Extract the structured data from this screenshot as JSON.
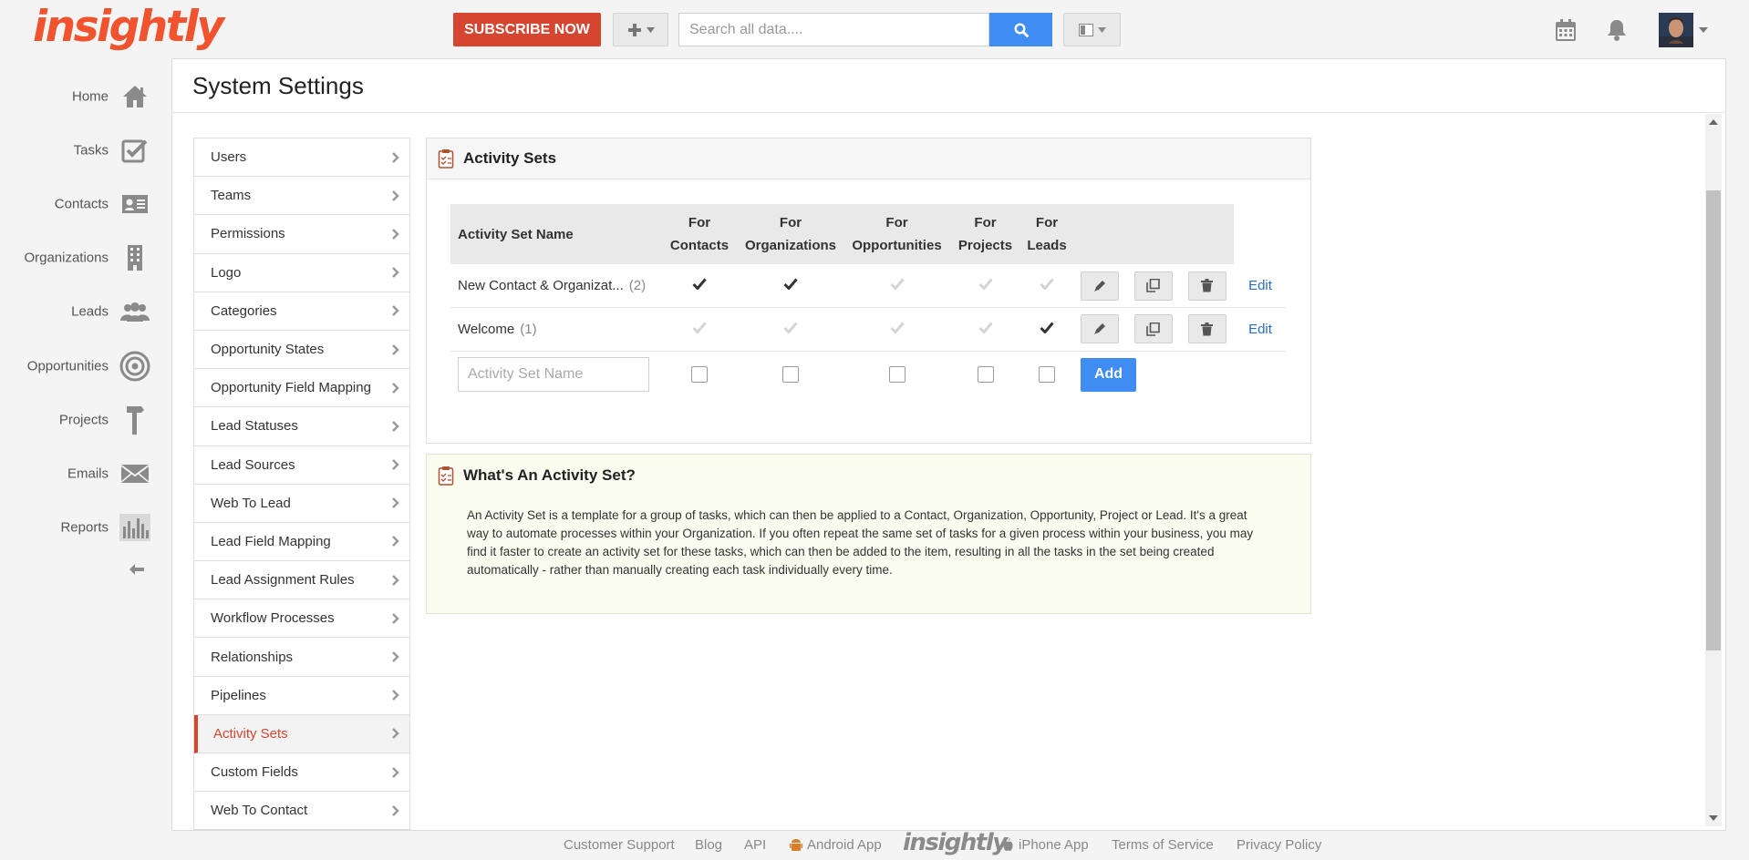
{
  "app": {
    "logo_text": "insightly",
    "brand_color": "#f0532d",
    "accent_color": "#3f8df2"
  },
  "topbar": {
    "subscribe_label": "SUBSCRIBE NOW",
    "add_icon": "plus-icon",
    "search_placeholder": "Search all data....",
    "search_icon": "search-icon",
    "layout_icon": "layout-icon",
    "calendar_icon": "calendar-icon",
    "bell_icon": "bell-icon",
    "avatar": "user-avatar"
  },
  "nav": {
    "items": [
      {
        "label": "Home",
        "icon": "home-icon"
      },
      {
        "label": "Tasks",
        "icon": "tasks-check-icon"
      },
      {
        "label": "Contacts",
        "icon": "contact-card-icon"
      },
      {
        "label": "Organizations",
        "icon": "building-icon"
      },
      {
        "label": "Leads",
        "icon": "people-icon"
      },
      {
        "label": "Opportunities",
        "icon": "target-icon"
      },
      {
        "label": "Projects",
        "icon": "hammer-icon"
      },
      {
        "label": "Emails",
        "icon": "envelope-icon"
      },
      {
        "label": "Reports",
        "icon": "bar-chart-icon"
      }
    ],
    "collapse_icon": "arrow-left-icon"
  },
  "page": {
    "title": "System Settings"
  },
  "settings": {
    "active": "Activity Sets",
    "items": [
      "Users",
      "Teams",
      "Permissions",
      "Logo",
      "Categories",
      "Opportunity States",
      "Opportunity Field Mapping",
      "Lead Statuses",
      "Lead Sources",
      "Web To Lead",
      "Lead Field Mapping",
      "Lead Assignment Rules",
      "Workflow Processes",
      "Relationships",
      "Pipelines",
      "Activity Sets",
      "Custom Fields",
      "Web To Contact"
    ]
  },
  "activity_sets": {
    "title": "Activity Sets",
    "columns": {
      "name": "Activity Set Name",
      "contacts": [
        "For",
        "Contacts"
      ],
      "organizations": [
        "For",
        "Organizations"
      ],
      "opportunities": [
        "For",
        "Opportunities"
      ],
      "projects": [
        "For",
        "Projects"
      ],
      "leads": [
        "For",
        "Leads"
      ]
    },
    "rows": [
      {
        "name": "New Contact & Organizat...",
        "count": "(2)",
        "checks": [
          true,
          true,
          false,
          false,
          false
        ],
        "edit_label": "Edit"
      },
      {
        "name": "Welcome",
        "count": "(1)",
        "checks": [
          false,
          false,
          false,
          false,
          true
        ],
        "edit_label": "Edit"
      }
    ],
    "new_row": {
      "placeholder": "Activity Set Name",
      "add_label": "Add"
    }
  },
  "info": {
    "title": "What's An Activity Set?",
    "body": "An Activity Set is a template for a group of tasks, which can then be applied to a Contact, Organization, Opportunity, Project or Lead. It's a great way to automate processes within your Organization. If you often repeat the same set of tasks for a given process within your business, you may find it faster to create an activity set for these tasks, which can then be added to the item, resulting in all the tasks in the set being created automatically - rather than manually creating each task individually every time."
  },
  "footer": {
    "customer_support": "Customer Support",
    "blog": "Blog",
    "api": "API",
    "android_app": "Android App",
    "logo_text": "insightly",
    "iphone_app": "iPhone App",
    "terms": "Terms of Service",
    "privacy": "Privacy Policy"
  }
}
